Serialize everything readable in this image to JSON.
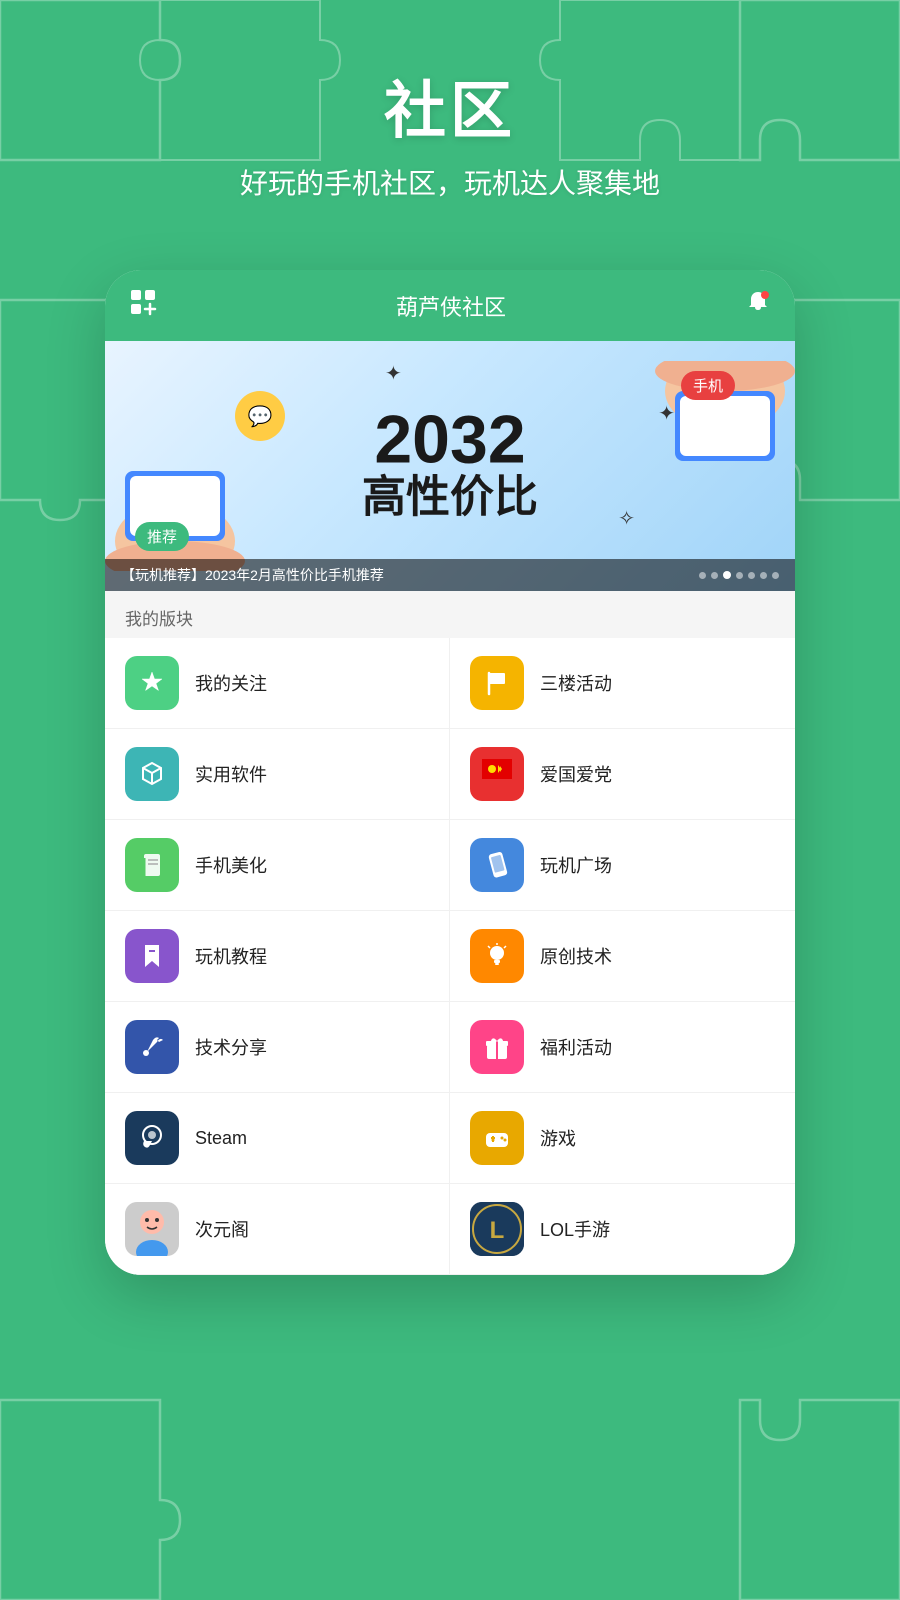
{
  "header": {
    "title": "社区",
    "subtitle": "好玩的手机社区，玩机达人聚集地"
  },
  "appBar": {
    "title": "葫芦侠社区",
    "leftIcon": "grid-plus-icon",
    "rightIcon": "bell-icon"
  },
  "banner": {
    "number": "2032",
    "text": "高性价比",
    "tagRecommend": "推荐",
    "tagPhone": "手机",
    "caption": "【玩机推荐】2023年2月高性价比手机推荐",
    "dots": [
      0,
      1,
      2,
      3,
      4,
      5,
      6
    ],
    "activeDot": 2
  },
  "sectionLabel": "我的版块",
  "gridItems": [
    {
      "id": "my-follow",
      "label": "我的关注",
      "icon": "star",
      "color": "icon-green"
    },
    {
      "id": "third-floor",
      "label": "三楼活动",
      "icon": "flag",
      "color": "icon-yellow"
    },
    {
      "id": "useful-apps",
      "label": "实用软件",
      "icon": "box",
      "color": "icon-teal"
    },
    {
      "id": "patriot",
      "label": "爱国爱党",
      "icon": "flag-red",
      "color": "icon-red"
    },
    {
      "id": "phone-beauty",
      "label": "手机美化",
      "icon": "book",
      "color": "icon-green2"
    },
    {
      "id": "play-square",
      "label": "玩机广场",
      "icon": "phone",
      "color": "icon-blue"
    },
    {
      "id": "play-tutorial",
      "label": "玩机教程",
      "icon": "bookmark",
      "color": "icon-purple"
    },
    {
      "id": "original-tech",
      "label": "原创技术",
      "icon": "bulb",
      "color": "icon-orange"
    },
    {
      "id": "tech-share",
      "label": "技术分享",
      "icon": "wrench",
      "color": "icon-gray-blue"
    },
    {
      "id": "welfare",
      "label": "福利活动",
      "icon": "gift",
      "color": "icon-pink"
    },
    {
      "id": "steam",
      "label": "Steam",
      "icon": "steam",
      "color": "icon-dark-blue"
    },
    {
      "id": "games",
      "label": "游戏",
      "icon": "game",
      "color": "icon-gold"
    },
    {
      "id": "anime",
      "label": "次元阁",
      "icon": "anime",
      "color": "icon-anime"
    },
    {
      "id": "lol",
      "label": "LOL手游",
      "icon": "lol",
      "color": "icon-lol"
    }
  ]
}
